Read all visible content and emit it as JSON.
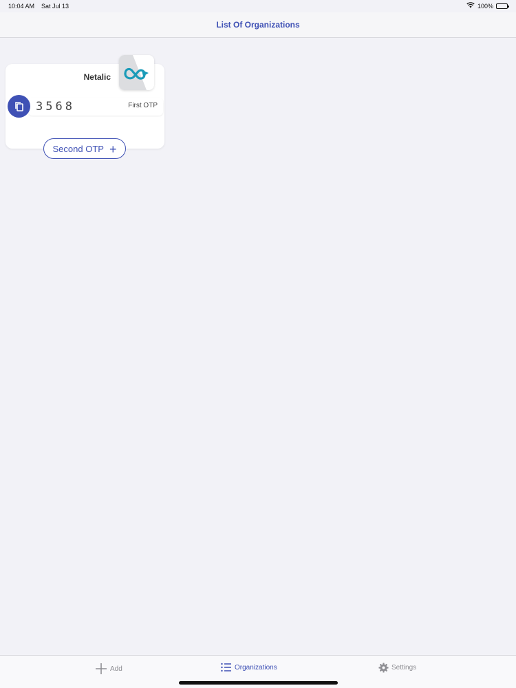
{
  "status_bar": {
    "time": "10:04 AM",
    "date": "Sat Jul 13",
    "battery": "100%"
  },
  "nav": {
    "title": "List Of Organizations"
  },
  "organizations": [
    {
      "name": "Netalic",
      "logo_icon": "infinity-logo-icon",
      "first_otp_code": "3568",
      "first_otp_label": "First OTP",
      "second_otp_label": "Second OTP"
    }
  ],
  "tabs": {
    "add": "Add",
    "organizations": "Organizations",
    "settings": "Settings"
  },
  "colors": {
    "accent": "#3f51b5",
    "logo_teal": "#1a9bb8",
    "background": "#f2f2f7"
  }
}
